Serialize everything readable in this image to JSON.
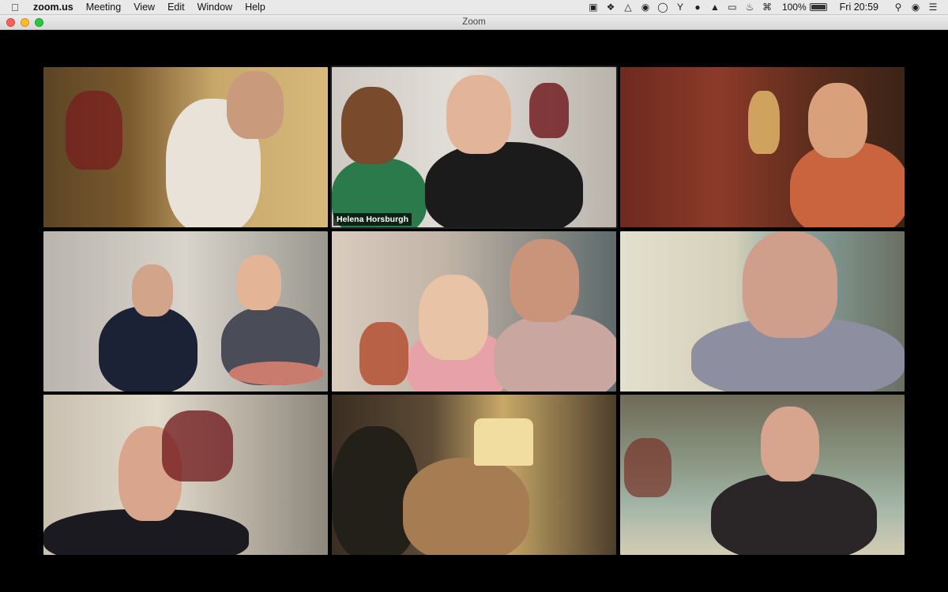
{
  "menubar": {
    "app_name": "zoom.us",
    "items": [
      "Meeting",
      "View",
      "Edit",
      "Window",
      "Help"
    ],
    "battery_percent": "100%",
    "battery_level": 1.0,
    "clock": "Fri 20:59",
    "tray_icons": [
      "zoom-icon",
      "dropbox-icon",
      "drive-icon",
      "chrome-icon",
      "1password-icon",
      "ycombinator-icon",
      "teams-icon",
      "alfred-icon",
      "airplay-icon",
      "volume-icon",
      "wifi-icon"
    ]
  },
  "window": {
    "title": "Zoom"
  },
  "participants": [
    {
      "name": "",
      "scene": "bookshelf"
    },
    {
      "name": "Helena Horsburgh",
      "scene": "window"
    },
    {
      "name": "",
      "scene": "red-room"
    },
    {
      "name": "",
      "scene": "couple-sofa"
    },
    {
      "name": "",
      "scene": "child-room"
    },
    {
      "name": "",
      "scene": "hallway"
    },
    {
      "name": "",
      "scene": "kitchen"
    },
    {
      "name": "",
      "scene": "lamp-room"
    },
    {
      "name": "",
      "scene": "mural"
    }
  ]
}
